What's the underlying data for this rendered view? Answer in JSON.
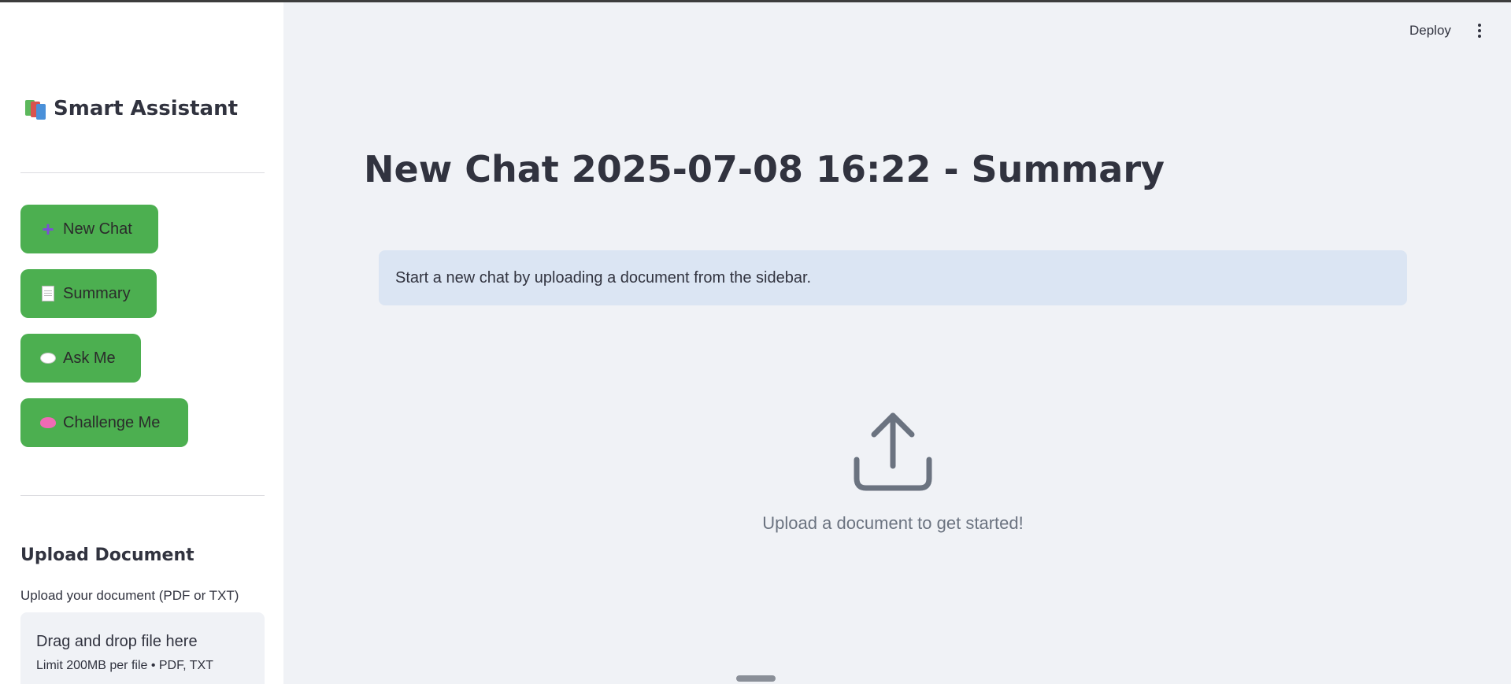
{
  "sidebar": {
    "brand_title": "Smart Assistant",
    "brand_icon": "books-icon",
    "nav": [
      {
        "label": "New Chat",
        "icon": "plus-icon"
      },
      {
        "label": "Summary",
        "icon": "document-icon"
      },
      {
        "label": "Ask Me",
        "icon": "speech-bubble-icon"
      },
      {
        "label": "Challenge Me",
        "icon": "brain-icon"
      }
    ],
    "button_color": "#4caf50",
    "upload": {
      "section_title": "Upload Document",
      "label": "Upload your document (PDF or TXT)",
      "drop_title": "Drag and drop file here",
      "drop_limit": "Limit 200MB per file • PDF, TXT"
    }
  },
  "header": {
    "deploy_label": "Deploy",
    "menu_icon": "more-vertical-icon"
  },
  "main": {
    "title": "New Chat 2025-07-08 16:22 - Summary",
    "info_message": "Start a new chat by uploading a document from the sidebar.",
    "info_color": "#dbe5f3",
    "empty_icon": "upload-icon",
    "empty_message": "Upload a document to get started!"
  }
}
